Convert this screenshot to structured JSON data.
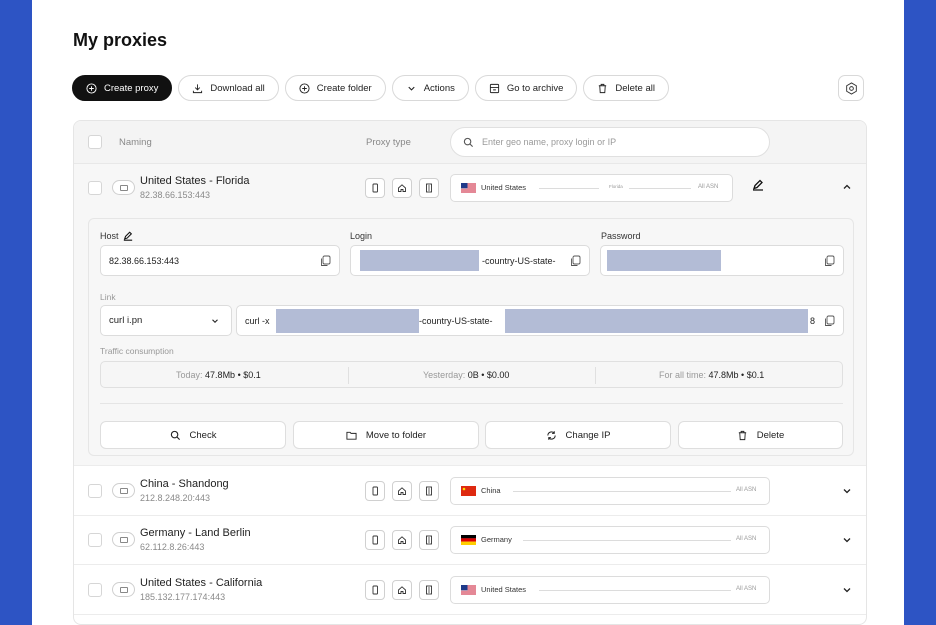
{
  "page": {
    "title": "My proxies"
  },
  "toolbar": {
    "create_proxy": "Create proxy",
    "download_all": "Download all",
    "create_folder": "Create folder",
    "actions": "Actions",
    "go_to_archive": "Go to archive",
    "delete_all": "Delete all"
  },
  "table": {
    "header": {
      "naming": "Naming",
      "proxy_type": "Proxy type",
      "search_placeholder": "Enter geo name, proxy login or IP"
    },
    "rows": [
      {
        "name": "United States - Florida",
        "address": "82.38.66.153:443",
        "country": "United States",
        "region": "Florida",
        "asn": "All ASN",
        "flag": "us"
      },
      {
        "name": "China - Shandong",
        "address": "212.8.248.20:443",
        "country": "China",
        "asn": "All ASN",
        "flag": "cn"
      },
      {
        "name": "Germany - Land Berlin",
        "address": "62.112.8.26:443",
        "country": "Germany",
        "asn": "All ASN",
        "flag": "de"
      },
      {
        "name": "United States - California",
        "address": "185.132.177.174:443",
        "country": "United States",
        "asn": "All ASN",
        "flag": "us"
      }
    ]
  },
  "detail": {
    "host_label": "Host",
    "host_value": "82.38.66.153:443",
    "login_label": "Login",
    "login_visible": "-country-US-state-",
    "password_label": "Password",
    "link_label": "Link",
    "link_format": "curl i.pn",
    "link_prefix": "curl -x",
    "link_middle": "-country-US-state-",
    "link_suffix": "8",
    "traffic_label": "Traffic consumption",
    "traffic": {
      "today_label": "Today:",
      "today_value": "47.8Mb • $0.1",
      "yesterday_label": "Yesterday:",
      "yesterday_value": "0B • $0.00",
      "all_time_label": "For all time:",
      "all_time_value": "47.8Mb • $0.1"
    },
    "actions": {
      "check": "Check",
      "move_to_folder": "Move to folder",
      "change_ip": "Change IP",
      "delete": "Delete"
    }
  },
  "icons": [
    "plus-circle-icon",
    "download-icon",
    "chevron-down-icon",
    "archive-icon",
    "trash-icon",
    "gear-icon",
    "search-icon",
    "phone-icon",
    "home-icon",
    "building-icon",
    "pencil-icon",
    "copy-icon",
    "folder-icon",
    "refresh-icon",
    "chevron-up-icon"
  ],
  "colors": {
    "accent": "#111111",
    "background": "#2d54c4",
    "mask": "#b3bcd6"
  }
}
